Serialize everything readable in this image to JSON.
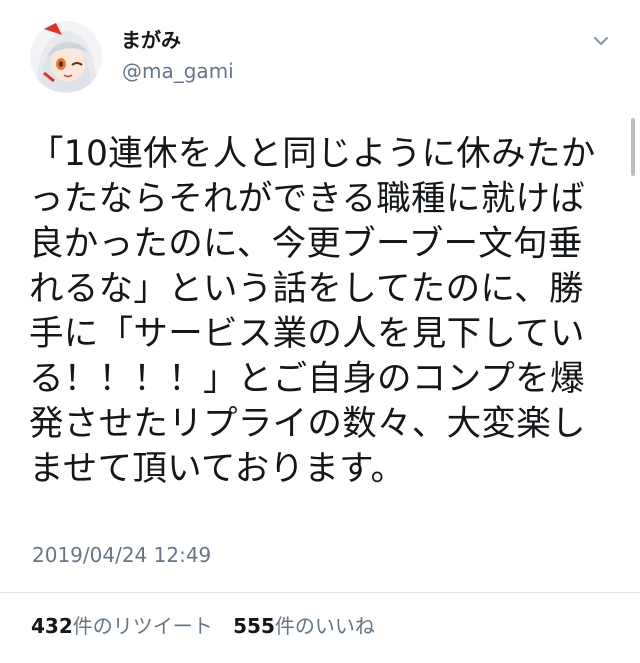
{
  "user": {
    "display_name": "まがみ",
    "handle": "@ma_gami",
    "avatar_icon": "anime-avatar-icon"
  },
  "menu": {
    "icon": "chevron-down-icon"
  },
  "tweet": {
    "lines": [
      "「10連休を人と同じように休みたか",
      "ったならそれができる職種に就けば",
      "良かったのに、今更ブーブー文句垂",
      "れるな」という話をしてたのに、勝",
      "手に「サービス業の人を見下してい",
      "る！！！！」とご自身のコンプを爆",
      "発させたリプライの数々、大変楽し",
      "ませて頂いております。"
    ],
    "timestamp": "2019/04/24 12:49"
  },
  "stats": {
    "retweets": {
      "count": "432",
      "label": "件のリツイート"
    },
    "likes": {
      "count": "555",
      "label": "件のいいね"
    }
  },
  "colors": {
    "text": "#14171a",
    "secondary": "#657786",
    "divider": "#e1e8ed"
  }
}
